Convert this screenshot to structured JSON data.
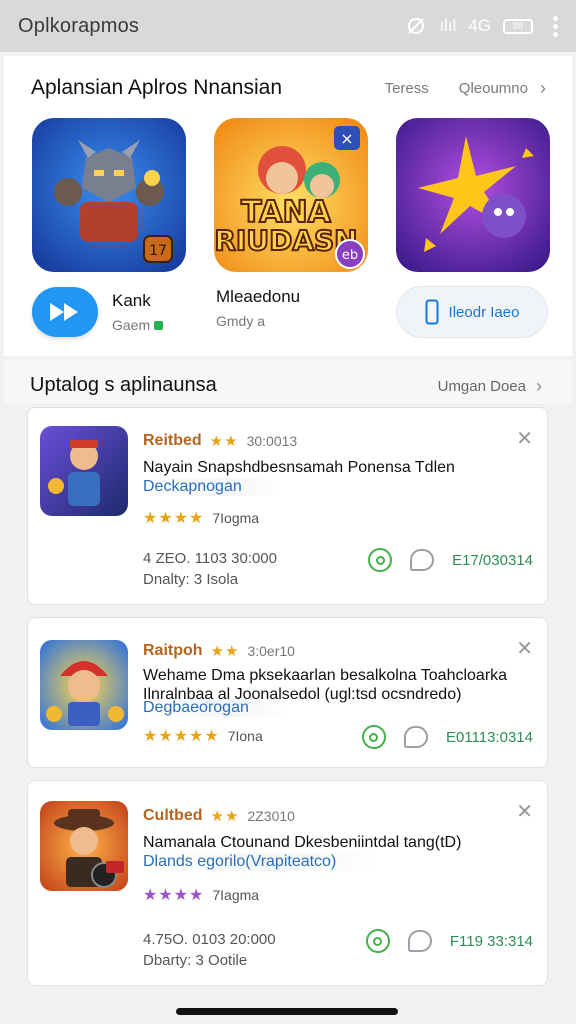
{
  "statusbar": {
    "title": "Oplkorapmos",
    "signal_text": "ılıl",
    "network_text": "4G",
    "battery_text": "88"
  },
  "featured": {
    "title": "Aplansian Aplros Nnansian",
    "link1": "Teress",
    "link2": "Qleoumno",
    "tiles": [
      {
        "label_line1": "TANA",
        "label_line2": "RIUDASN",
        "badge": "eb"
      },
      {
        "badge": "17"
      },
      {}
    ],
    "mini_app_1": {
      "name": "Kank",
      "sub": "Gaem"
    },
    "mini_app_2": {
      "name": "Mleaedonu",
      "sub": "Gmdy a"
    },
    "pill_label": "Ileodr Iaeo"
  },
  "updates": {
    "title": "Uptalog s aplinaunsa",
    "link": "Umgan Doea"
  },
  "cards": [
    {
      "name": "Reitbed",
      "stars": "★★",
      "date": "30:0013",
      "desc": "Nayain Snapshdbesnsamah Ponensa Tdlen",
      "link": "Deckapnogan",
      "rating_stars": "★★★★",
      "rating_text": "7Iogma",
      "meta1": "4 ZEO. 1103 30:000",
      "meta2": "Dnalty: 3 Isola",
      "code": "E17/030314",
      "rating_color": "#e6a417"
    },
    {
      "name": "Raitpoh",
      "stars": "★★",
      "date": "3:0er10",
      "desc": "Wehame Dma pksekaarlan besalkolna Toahcloarka Ilnralnbaa al Joonalsedol (ugl:tsd ocsndredo)",
      "link": "Degbaeorogan",
      "rating_stars": "★★★★★",
      "rating_text": "7Iona",
      "code": "E01113:0314",
      "rating_color": "#e6a417"
    },
    {
      "name": "Cultbed",
      "stars": "★★",
      "date": "2Z3010",
      "desc": "Namanala Ctounand Dkesbeniintdal tang(tD)",
      "link": "Dlands egorilo(Vrapiteatco)",
      "rating_stars": "★★★★",
      "rating_text": "7Iagma",
      "meta1": "4.75O. 0103 20:000",
      "meta2": "Dbarty: 3 Ootile",
      "code": "F119 33:314",
      "rating_color": "#9c52c9"
    }
  ]
}
